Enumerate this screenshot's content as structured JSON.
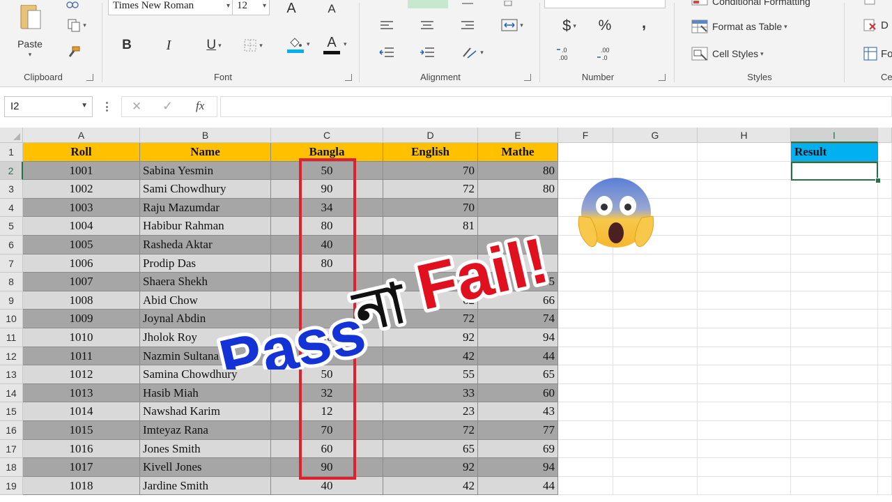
{
  "ribbon": {
    "clipboard": {
      "label": "Clipboard",
      "paste_label": "Paste"
    },
    "font": {
      "label": "Font",
      "font_name": "Times New Roman",
      "font_size": "12",
      "grow_label": "A",
      "shrink_label": "A",
      "bold": "B",
      "italic": "I",
      "underline": "U",
      "font_color_label": "A"
    },
    "alignment": {
      "label": "Alignment"
    },
    "number": {
      "label": "Number",
      "currency": "$",
      "percent": "%",
      "comma": ",",
      "inc_decimal": "←.0\n.00",
      "dec_decimal": ".00\n→.0"
    },
    "styles": {
      "label": "Styles",
      "conditional_formatting": "Conditional Formatting",
      "format_as_table": "Format as Table",
      "cell_styles": "Cell Styles"
    },
    "cells": {
      "label": "Ce",
      "delete": "D",
      "format": "Fo"
    }
  },
  "formula_bar": {
    "name_box": "I2",
    "cancel": "✕",
    "enter": "✓",
    "fx": "fx",
    "formula": ""
  },
  "sheet": {
    "columns": [
      "A",
      "B",
      "C",
      "D",
      "E",
      "F",
      "G",
      "H",
      "I"
    ],
    "selected_column": "I",
    "selected_row": "2",
    "rows": [
      "1",
      "2",
      "3",
      "4",
      "5",
      "6",
      "7",
      "8",
      "9",
      "10",
      "11",
      "12",
      "13",
      "14",
      "15",
      "16",
      "17",
      "18",
      "19"
    ],
    "headers": {
      "roll": "Roll",
      "name": "Name",
      "bangla": "Bangla",
      "english": "English",
      "mathe": "Mathe",
      "result": "Result"
    },
    "data": [
      {
        "roll": "1001",
        "name": "Sabina Yesmin",
        "bangla": "50",
        "english": "70",
        "mathe": "80"
      },
      {
        "roll": "1002",
        "name": "Sami Chowdhury",
        "bangla": "90",
        "english": "72",
        "mathe": "80"
      },
      {
        "roll": "1003",
        "name": "Raju Mazumdar",
        "bangla": "34",
        "english": "70",
        "mathe": ""
      },
      {
        "roll": "1004",
        "name": "Habibur Rahman",
        "bangla": "80",
        "english": "81",
        "mathe": ""
      },
      {
        "roll": "1005",
        "name": "Rasheda Aktar",
        "bangla": "40",
        "english": "",
        "mathe": ""
      },
      {
        "roll": "1006",
        "name": "Prodip Das",
        "bangla": "80",
        "english": "",
        "mathe": ""
      },
      {
        "roll": "1007",
        "name": "Shaera Shekh",
        "bangla": "",
        "english": "",
        "mathe": "55"
      },
      {
        "roll": "1008",
        "name": "Abid Chow",
        "bangla": "",
        "english": "62",
        "mathe": "66"
      },
      {
        "roll": "1009",
        "name": "Joynal Abdin",
        "bangla": "",
        "english": "72",
        "mathe": "74"
      },
      {
        "roll": "1010",
        "name": "Jholok  Roy",
        "bangla": "90",
        "english": "92",
        "mathe": "94"
      },
      {
        "roll": "1011",
        "name": "Nazmin Sultana",
        "bangla": "40",
        "english": "42",
        "mathe": "44"
      },
      {
        "roll": "1012",
        "name": "Samina Chowdhury",
        "bangla": "50",
        "english": "55",
        "mathe": "65"
      },
      {
        "roll": "1013",
        "name": "Hasib Miah",
        "bangla": "32",
        "english": "33",
        "mathe": "60"
      },
      {
        "roll": "1014",
        "name": "Nawshad Karim",
        "bangla": "12",
        "english": "23",
        "mathe": "43"
      },
      {
        "roll": "1015",
        "name": "Imteyaz Rana",
        "bangla": "70",
        "english": "72",
        "mathe": "77"
      },
      {
        "roll": "1016",
        "name": "Jones Smith",
        "bangla": "60",
        "english": "65",
        "mathe": "69"
      },
      {
        "roll": "1017",
        "name": "Kivell Jones",
        "bangla": "90",
        "english": "92",
        "mathe": "94"
      },
      {
        "roll": "1018",
        "name": "Jardine Smith",
        "bangla": "40",
        "english": "42",
        "mathe": "44"
      }
    ]
  },
  "overlay": {
    "pass": "Pass",
    "na": "না",
    "fail": "Fail!",
    "emoji": "😱"
  },
  "colors": {
    "header_fill": "#ffc000",
    "result_fill": "#00b0f0",
    "row_dark": "#a6a6a6",
    "row_light": "#d9d9d9",
    "highlight_box": "#e0202e",
    "pass_blue": "#1433d6",
    "fail_red": "#e0101e",
    "excel_green": "#217346"
  }
}
